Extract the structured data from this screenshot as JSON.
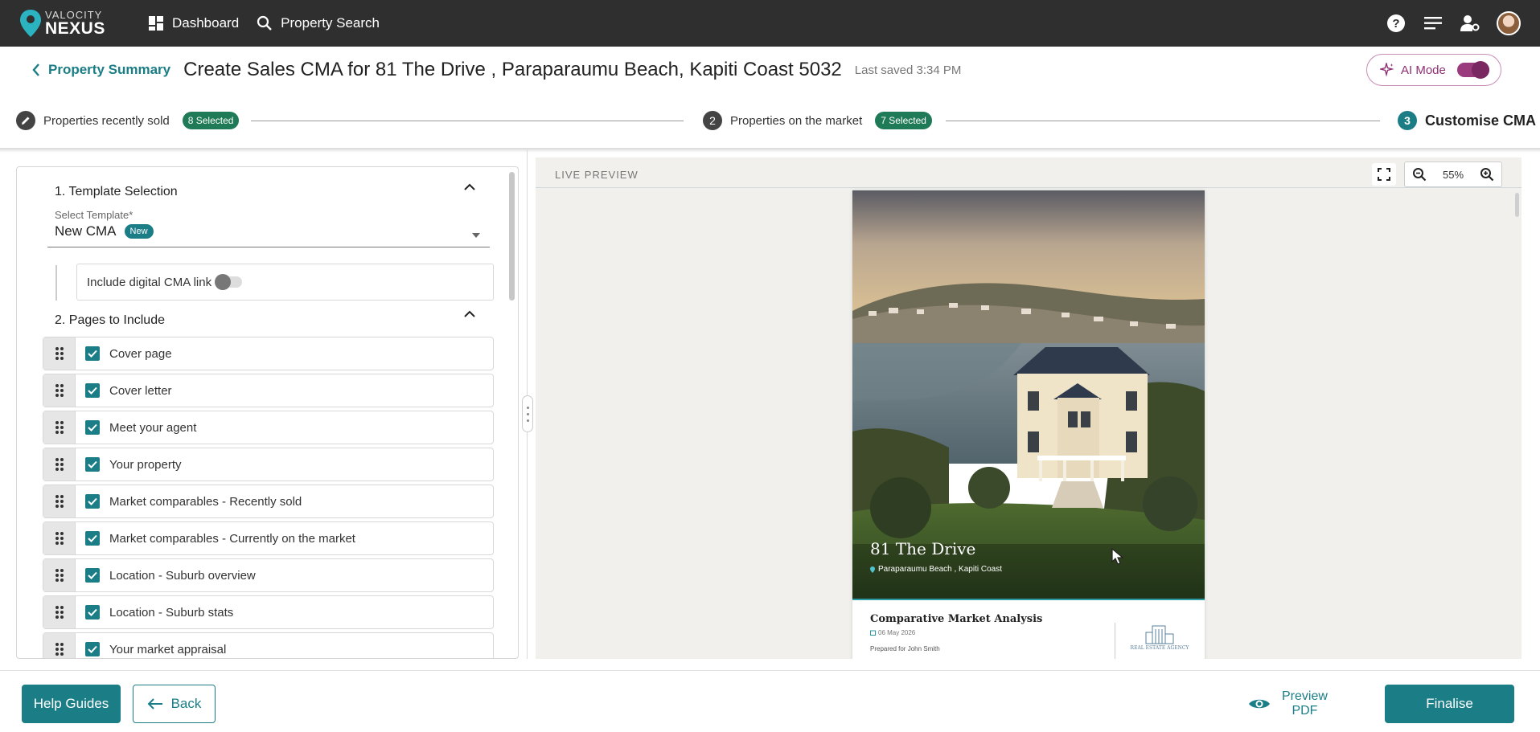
{
  "app": {
    "logo_top": "VALOCITY",
    "logo_bottom": "NEXUS",
    "nav": [
      {
        "label": "Dashboard"
      },
      {
        "label": "Property Search"
      }
    ]
  },
  "header": {
    "back_label": "Property Summary",
    "title": "Create Sales CMA for 81 The Drive , Paraparaumu Beach, Kapiti Coast 5032",
    "last_saved": "Last saved 3:34 PM",
    "ai_mode_label": "AI Mode",
    "ai_mode_on": true
  },
  "stepper": {
    "steps": [
      {
        "label": "Properties recently sold",
        "badge": "8 Selected",
        "icon": "pencil-icon"
      },
      {
        "label": "Properties on the market",
        "badge": "7 Selected",
        "number": "2"
      },
      {
        "label": "Customise CMA",
        "number": "3"
      }
    ]
  },
  "left_panel": {
    "template_section_title": "1. Template Selection",
    "select_label": "Select Template*",
    "select_value": "New CMA",
    "new_badge": "New",
    "digital_link_label": "Include digital CMA link",
    "pages_section_title": "2. Pages to Include",
    "pages": [
      {
        "label": "Cover page",
        "checked": true
      },
      {
        "label": "Cover letter",
        "checked": true
      },
      {
        "label": "Meet your agent",
        "checked": true
      },
      {
        "label": "Your property",
        "checked": true
      },
      {
        "label": "Market comparables - Recently sold",
        "checked": true
      },
      {
        "label": "Market comparables - Currently on the market",
        "checked": true
      },
      {
        "label": "Location - Suburb overview",
        "checked": true
      },
      {
        "label": "Location - Suburb stats",
        "checked": true
      },
      {
        "label": "Your market appraisal",
        "checked": true
      }
    ]
  },
  "preview": {
    "label": "LIVE PREVIEW",
    "zoom": "55%",
    "doc": {
      "cover_title": "81 The Drive",
      "cover_location": "Paraparaumu Beach , Kapiti Coast",
      "cma_title": "Comparative Market Analysis",
      "cma_date": "06 May 2026",
      "prepared_for": "Prepared for John Smith",
      "agency_name": "REAL ESTATE AGENCY"
    }
  },
  "footer": {
    "help_label": "Help Guides",
    "back_label": "Back",
    "preview_line1": "Preview",
    "preview_line2": "PDF",
    "finalise_label": "Finalise"
  },
  "colors": {
    "primary": "#1b7d86",
    "topbar": "#2f2f2f",
    "badge_green": "#1f7a57",
    "ai_purple": "#9a3b7e"
  }
}
